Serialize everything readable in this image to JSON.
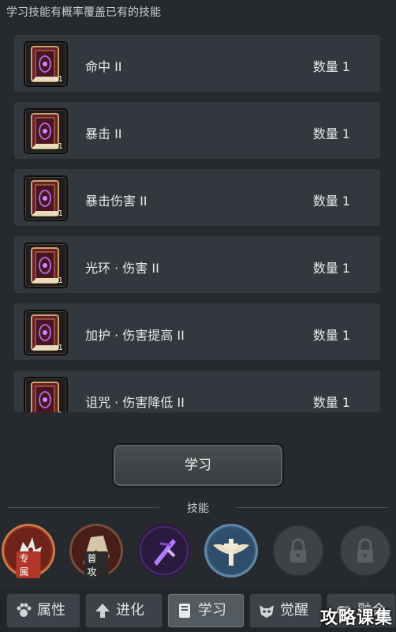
{
  "hint": "学习技能有概率覆盖已有的技能",
  "skill_books": [
    {
      "name": "命中 II",
      "count": "1",
      "qty": "数量 1"
    },
    {
      "name": "暴击 II",
      "count": "1",
      "qty": "数量 1"
    },
    {
      "name": "暴击伤害 II",
      "count": "1",
      "qty": "数量 1"
    },
    {
      "name": "光环 · 伤害 II",
      "count": "1",
      "qty": "数量 1"
    },
    {
      "name": "加护 · 伤害提高 II",
      "count": "1",
      "qty": "数量 1"
    },
    {
      "name": "诅咒 · 伤害降低 II",
      "count": "1",
      "qty": "数量 1"
    }
  ],
  "learn_button": "学习",
  "skills_section_title": "技能",
  "skills": [
    {
      "icon": "exclusive-beast-icon",
      "tag": "专属",
      "color": "#8a2b1e"
    },
    {
      "icon": "basic-attack-icon",
      "tag": "普攻",
      "color": "#3a1f1a"
    },
    {
      "icon": "purple-sword-icon",
      "tag": "",
      "color": "#4a2b6a"
    },
    {
      "icon": "winged-cross-icon",
      "tag": "",
      "color": "#3a5a78"
    },
    {
      "icon": "lock-icon",
      "tag": "",
      "color": "#3c4246"
    },
    {
      "icon": "lock-icon",
      "tag": "",
      "color": "#3c4246"
    }
  ],
  "tabs": [
    {
      "label": "属性",
      "icon": "paw-icon",
      "active": false
    },
    {
      "label": "进化",
      "icon": "arrow-up-icon",
      "active": false
    },
    {
      "label": "学习",
      "icon": "book-icon",
      "active": true
    },
    {
      "label": "觉醒",
      "icon": "mask-icon",
      "active": false
    },
    {
      "label": "融合",
      "icon": "fusion-icon",
      "active": false
    }
  ],
  "watermark": "攻略课集"
}
